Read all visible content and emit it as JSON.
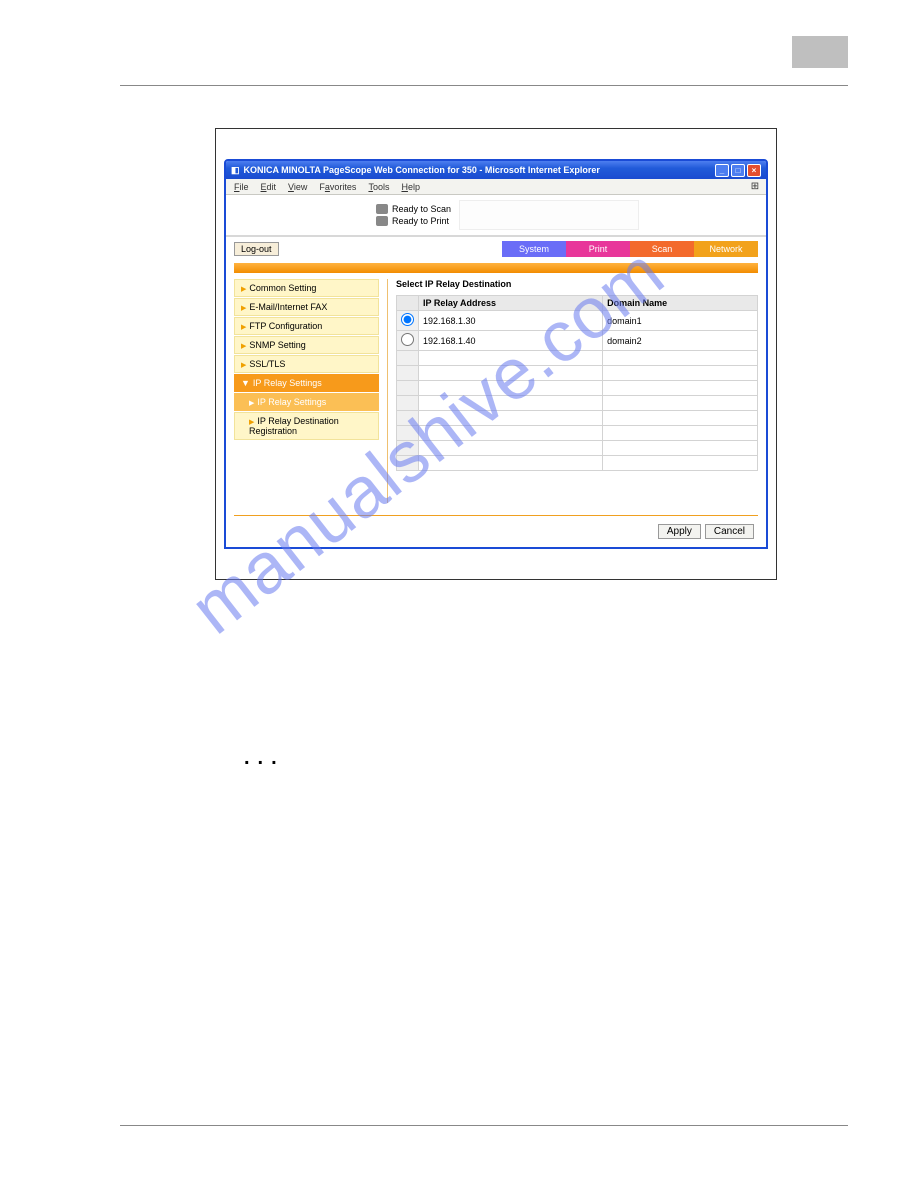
{
  "window": {
    "title": "KONICA MINOLTA PageScope Web Connection for 350 - Microsoft Internet Explorer",
    "menu": [
      "File",
      "Edit",
      "View",
      "Favorites",
      "Tools",
      "Help"
    ]
  },
  "status": {
    "scan": "Ready to Scan",
    "print": "Ready to Print"
  },
  "logout": "Log-out",
  "tabs": {
    "system": "System",
    "print": "Print",
    "scan": "Scan",
    "network": "Network"
  },
  "sidebar": {
    "items": [
      "Common Setting",
      "E-Mail/Internet FAX",
      "FTP Configuration",
      "SNMP Setting",
      "SSL/TLS"
    ],
    "activeParent": "IP Relay Settings",
    "child": "IP Relay Settings",
    "child2": "IP Relay Destination Registration"
  },
  "main": {
    "heading": "Select IP Relay Destination",
    "columns": {
      "radio": "",
      "addr": "IP Relay Address",
      "domain": "Domain Name"
    },
    "rows": [
      {
        "selected": true,
        "addr": "192.168.1.30",
        "domain": "domain1"
      },
      {
        "selected": false,
        "addr": "192.168.1.40",
        "domain": "domain2"
      },
      {
        "selected": null,
        "addr": "",
        "domain": ""
      },
      {
        "selected": null,
        "addr": "",
        "domain": ""
      },
      {
        "selected": null,
        "addr": "",
        "domain": ""
      },
      {
        "selected": null,
        "addr": "",
        "domain": ""
      },
      {
        "selected": null,
        "addr": "",
        "domain": ""
      },
      {
        "selected": null,
        "addr": "",
        "domain": ""
      },
      {
        "selected": null,
        "addr": "",
        "domain": ""
      },
      {
        "selected": null,
        "addr": "",
        "domain": ""
      }
    ]
  },
  "buttons": {
    "apply": "Apply",
    "cancel": "Cancel"
  },
  "watermark": "manualshive.com",
  "dots": "..."
}
